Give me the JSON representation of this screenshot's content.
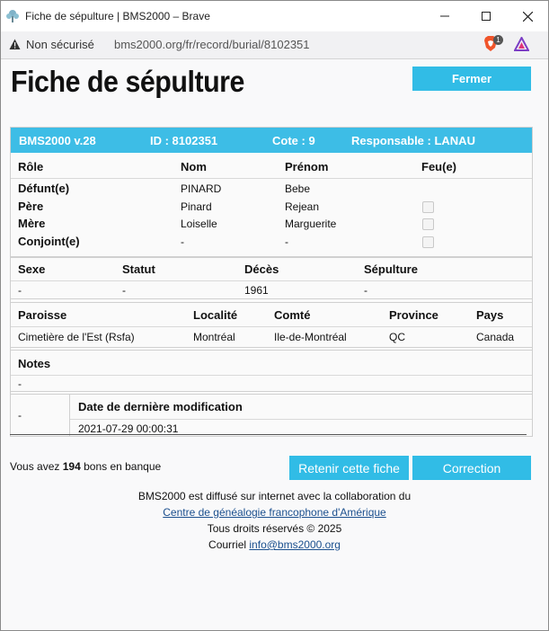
{
  "browser": {
    "window_title": "Fiche de sépulture | BMS2000 – Brave",
    "security_label": "Non sécurisé",
    "url": "bms2000.org/fr/record/burial/8102351",
    "shield_badge": "1"
  },
  "page": {
    "title": "Fiche de sépulture",
    "close_label": "Fermer"
  },
  "record": {
    "version": "BMS2000 v.28",
    "id": "ID : 8102351",
    "cote": "Cote : 9",
    "responsable": "Responsable : LANAU",
    "persons": {
      "headers": {
        "role": "Rôle",
        "nom": "Nom",
        "prenom": "Prénom",
        "feu": "Feu(e)"
      },
      "rows": [
        {
          "role": "Défunt(e)",
          "nom": "PINARD",
          "prenom": "Bebe"
        },
        {
          "role": "Père",
          "nom": "Pinard",
          "prenom": "Rejean"
        },
        {
          "role": "Mère",
          "nom": "Loiselle",
          "prenom": "Marguerite"
        },
        {
          "role": "Conjoint(e)",
          "nom": "-",
          "prenom": "-"
        }
      ]
    },
    "details": {
      "headers": {
        "sexe": "Sexe",
        "statut": "Statut",
        "deces": "Décès",
        "sepulture": "Sépulture"
      },
      "values": {
        "sexe": "-",
        "statut": "-",
        "deces": "1961",
        "sepulture": "-"
      }
    },
    "place": {
      "headers": {
        "paroisse": "Paroisse",
        "localite": "Localité",
        "comte": "Comté",
        "province": "Province",
        "pays": "Pays"
      },
      "values": {
        "paroisse": "Cimetière de l'Est (Rsfa)",
        "localite": "Montréal",
        "comte": "Ile-de-Montréal",
        "province": "QC",
        "pays": "Canada"
      }
    },
    "notes": {
      "header": "Notes",
      "value": "-"
    },
    "modification": {
      "left": "-",
      "header": "Date de dernière modification",
      "value": "2021-07-29 00:00:31"
    }
  },
  "bank": {
    "prefix": "Vous avez",
    "count": "194",
    "suffix": "bons en banque"
  },
  "actions": {
    "retain_label": "Retenir cette fiche",
    "correction_label": "Correction"
  },
  "footer": {
    "line1": "BMS2000 est diffusé sur internet avec la collaboration du",
    "link": "Centre de généalogie francophone d'Amérique",
    "rights": "Tous droits réservés © 2025",
    "contact_prefix": "Courriel",
    "email": "info@bms2000.org"
  },
  "colors": {
    "accent": "#31bce6",
    "header_bg": "#3dbde6",
    "link": "#1a4f8e"
  }
}
